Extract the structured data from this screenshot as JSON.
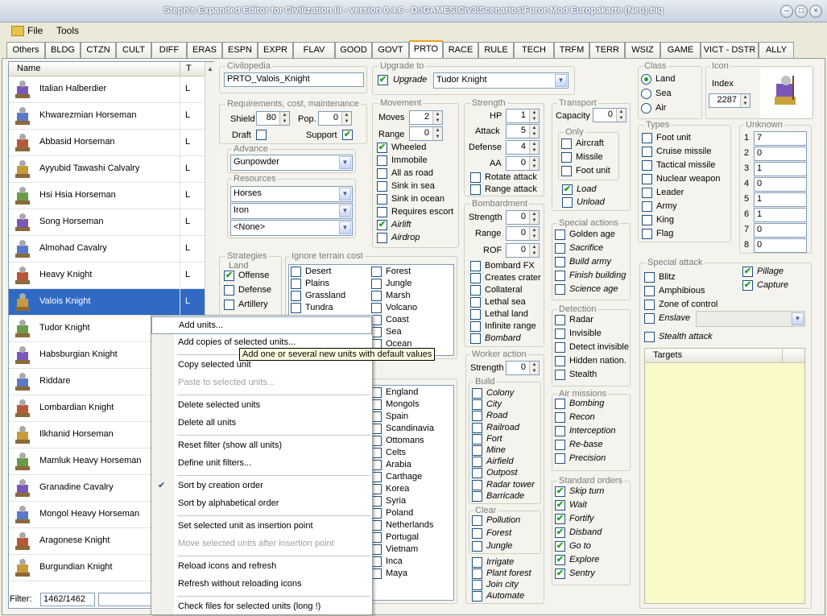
{
  "window": {
    "title": "Steph's Expanded Editor for Civilization III - version 0.4.6 - D:\\GAMES\\Civ3\\Scenarios\\Furor-Mod Europakarte (Neu).biq"
  },
  "menu": {
    "file": "File",
    "tools": "Tools"
  },
  "tabs": [
    "Others",
    "BLDG",
    "CTZN",
    "CULT",
    "DIFF",
    "ERAS",
    "ESPN",
    "EXPR",
    "FLAV",
    "GOOD",
    "GOVT",
    "PRTO",
    "RACE",
    "RULE",
    "TECH",
    "TRFM",
    "TERR",
    "WSIZ",
    "GAME",
    "VICT - DSTR",
    "ALLY"
  ],
  "list": {
    "col_name": "Name",
    "col_t": "T",
    "units": [
      {
        "name": "Italian Halberdier",
        "t": "L"
      },
      {
        "name": "Khwarezmian Horseman",
        "t": "L"
      },
      {
        "name": "Abbasid Horseman",
        "t": "L"
      },
      {
        "name": "Ayyubid Tawashi Calvalry",
        "t": "L"
      },
      {
        "name": "Hsi Hsia Horseman",
        "t": "L"
      },
      {
        "name": "Song Horseman",
        "t": "L"
      },
      {
        "name": "Almohad Cavalry",
        "t": "L"
      },
      {
        "name": "Heavy Knight",
        "t": "L"
      },
      {
        "name": "Valois Knight",
        "t": "L"
      },
      {
        "name": "Tudor Knight",
        "t": ""
      },
      {
        "name": "Habsburgian Knight",
        "t": ""
      },
      {
        "name": "Riddare",
        "t": ""
      },
      {
        "name": "Lombardian Knight",
        "t": ""
      },
      {
        "name": "Ilkhanid Horseman",
        "t": ""
      },
      {
        "name": "Mamluk Heavy Horseman",
        "t": ""
      },
      {
        "name": "Granadine Cavalry",
        "t": ""
      },
      {
        "name": "Mongol Heavy Horseman",
        "t": ""
      },
      {
        "name": "Aragonese Knight",
        "t": ""
      },
      {
        "name": "Burgundian Knight",
        "t": ""
      }
    ],
    "selected_index": 8
  },
  "filter": {
    "label": "Filter:",
    "count": "1462/1462"
  },
  "civilopedia": {
    "label": "Civilopedia",
    "value": "PRTO_Valois_Knight"
  },
  "upgrade": {
    "label": "Upgrade to",
    "check": "Upgrade",
    "value": "Tudor Knight"
  },
  "req": {
    "label": "Requirements, cost, maintenance",
    "shield": "Shield",
    "shield_val": "80",
    "pop": "Pop.",
    "pop_val": "0",
    "draft": "Draft",
    "support": "Support"
  },
  "advance": {
    "label": "Advance",
    "value": "Gunpowder"
  },
  "resources": {
    "label": "Resources",
    "values": [
      "Horses",
      "Iron",
      "<None>"
    ]
  },
  "movement": {
    "label": "Movement",
    "moves": "Moves",
    "moves_val": "2",
    "range": "Range",
    "range_val": "0",
    "flags": [
      {
        "l": "Wheeled",
        "c": true,
        "i": false
      },
      {
        "l": "Immobile",
        "c": false,
        "i": false
      },
      {
        "l": "All as road",
        "c": false,
        "i": false
      },
      {
        "l": "Sink in sea",
        "c": false,
        "i": false
      },
      {
        "l": "Sink in ocean",
        "c": false,
        "i": false
      },
      {
        "l": "Requires escort",
        "c": false,
        "i": false
      },
      {
        "l": "Airlift",
        "c": true,
        "i": true
      },
      {
        "l": "Airdrop",
        "c": false,
        "i": true
      }
    ]
  },
  "strength": {
    "label": "Strength",
    "hp": "HP",
    "hp_val": "1",
    "attack": "Attack",
    "attack_val": "5",
    "defense": "Defense",
    "defense_val": "4",
    "aa": "AA",
    "aa_val": "0",
    "rotate": "Rotate attack",
    "range": "Range attack"
  },
  "bombard": {
    "label": "Bombardment",
    "strength": "Strength",
    "strength_val": "0",
    "range": "Range",
    "range_val": "0",
    "rof": "ROF",
    "rof_val": "0",
    "flags": [
      {
        "l": "Bombard FX",
        "i": false
      },
      {
        "l": "Creates crater",
        "i": false
      },
      {
        "l": "Collateral",
        "i": false
      },
      {
        "l": "Lethal sea",
        "i": false
      },
      {
        "l": "Lethal land",
        "i": false
      },
      {
        "l": "Infinite range",
        "i": false
      },
      {
        "l": "Bombard",
        "i": true
      }
    ]
  },
  "worker": {
    "label": "Worker action",
    "strength": "Strength",
    "strength_val": "0",
    "build_label": "Build",
    "build": [
      "Colony",
      "City",
      "Road",
      "Railroad",
      "Fort",
      "Mine",
      "Airfield",
      "Outpost",
      "Radar tower",
      "Barricade"
    ],
    "clear_label": "Clear",
    "clear": [
      "Pollution",
      "Forest",
      "Jungle"
    ],
    "other": [
      "Irrigate",
      "Plant forest",
      "Join city",
      "Automate"
    ]
  },
  "transport": {
    "label": "Transport",
    "capacity": "Capacity",
    "capacity_val": "0",
    "only": "Only",
    "only_items": [
      "Aircraft",
      "Missile",
      "Foot unit"
    ],
    "load": "Load",
    "unload": "Unload"
  },
  "special_actions": {
    "label": "Special actions",
    "items": [
      "Golden age",
      "Sacrifice",
      "Build army",
      "Finish building",
      "Science age"
    ]
  },
  "detection": {
    "label": "Detection",
    "items": [
      "Radar",
      "Invisible",
      "Detect invisible",
      "Hidden nation.",
      "Stealth"
    ]
  },
  "air": {
    "label": "Air missions",
    "items": [
      "Bombing",
      "Recon",
      "Interception",
      "Re-base",
      "Precision"
    ]
  },
  "orders": {
    "label": "Standard orders",
    "items": [
      "Skip turn",
      "Wait",
      "Fortify",
      "Disband",
      "Go to",
      "Explore",
      "Sentry"
    ]
  },
  "class": {
    "label": "Class",
    "items": [
      "Land",
      "Sea",
      "Air"
    ],
    "selected": "Land"
  },
  "icon": {
    "label": "Icon",
    "index_label": "Index",
    "index_val": "2287"
  },
  "types": {
    "label": "Types",
    "items": [
      "Foot unit",
      "Cruise missile",
      "Tactical missile",
      "Nuclear weapon",
      "Leader",
      "Army",
      "King",
      "Flag"
    ]
  },
  "unknown": {
    "label": "Unknown",
    "rows": [
      {
        "n": "1",
        "v": "7"
      },
      {
        "n": "2",
        "v": "0"
      },
      {
        "n": "3",
        "v": "1"
      },
      {
        "n": "4",
        "v": "0"
      },
      {
        "n": "5",
        "v": "1"
      },
      {
        "n": "6",
        "v": "1"
      },
      {
        "n": "7",
        "v": "0"
      },
      {
        "n": "8",
        "v": "0"
      }
    ]
  },
  "special_attack": {
    "label": "Special attack",
    "blitz": "Blitz",
    "pillage": "Pillage",
    "amphibious": "Amphibious",
    "capture": "Capture",
    "zoc": "Zone of control",
    "enslave": "Enslave",
    "stealth": "Stealth attack",
    "targets": "Targets"
  },
  "strategies": {
    "label": "Strategies",
    "land": "Land",
    "items": [
      "Offense",
      "Defense",
      "Artillery"
    ]
  },
  "ignore": {
    "label": "Ignore terrain cost",
    "col1": [
      "Desert",
      "Plains",
      "Grassland",
      "Tundra"
    ],
    "col2": [
      "Forest",
      "Jungle",
      "Marsh",
      "Volcano",
      "Coast",
      "Sea",
      "Ocean"
    ]
  },
  "civs": {
    "col": [
      "England",
      "Mongols",
      "Spain",
      "Scandinavia",
      "Ottomans",
      "Celts",
      "Arabia",
      "Carthage",
      "Korea",
      "Syria",
      "Poland",
      "Netherlands",
      "Portugal",
      "Vietnam",
      "Inca",
      "Maya"
    ]
  },
  "context_menu": {
    "items": [
      {
        "l": "Add units...",
        "d": false,
        "sep": false
      },
      {
        "l": "Add copies of selected units...",
        "d": false,
        "sep": false
      },
      {
        "l": "Copy selected unit",
        "d": false,
        "sep": true
      },
      {
        "l": "Paste to selected units...",
        "d": true,
        "sep": false
      },
      {
        "l": "Delete selected units",
        "d": false,
        "sep": true
      },
      {
        "l": "Delete all units",
        "d": false,
        "sep": false
      },
      {
        "l": "Reset filter (show all units)",
        "d": false,
        "sep": true
      },
      {
        "l": "Define unit filters...",
        "d": false,
        "sep": false
      },
      {
        "l": "Sort by creation order",
        "d": false,
        "sep": true,
        "checked": true
      },
      {
        "l": "Sort by alphabetical order",
        "d": false,
        "sep": false
      },
      {
        "l": "Set selected unit as insertion point",
        "d": false,
        "sep": true
      },
      {
        "l": "Move selected units after insertion point",
        "d": true,
        "sep": false
      },
      {
        "l": "Reload icons and refresh",
        "d": false,
        "sep": true
      },
      {
        "l": "Refresh without reloading icons",
        "d": false,
        "sep": false
      },
      {
        "l": "Check files for selected units (long !)",
        "d": false,
        "sep": true
      }
    ]
  },
  "tooltip": "Add one or several new units with default values"
}
